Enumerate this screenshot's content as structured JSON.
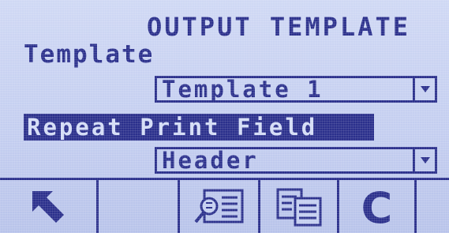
{
  "header": {
    "title": "OUTPUT TEMPLATE"
  },
  "form": {
    "field_label": "Template",
    "template_select": {
      "value": "Template 1",
      "arrow_icon": "dropdown-arrow-icon"
    },
    "repeat_print_field": {
      "label": "Repeat Print Field",
      "value": "Header",
      "arrow_icon": "dropdown-arrow-icon"
    }
  },
  "softkeys": [
    {
      "icon": "exit-arrow-icon"
    },
    {
      "icon": ""
    },
    {
      "icon": "view-template-icon"
    },
    {
      "icon": "copy-icon"
    },
    {
      "label": "C",
      "icon": "clear-icon"
    },
    {
      "icon": ""
    }
  ],
  "colors": {
    "lcd_background": "#c4cef0",
    "lcd_foreground": "#2b308c"
  }
}
